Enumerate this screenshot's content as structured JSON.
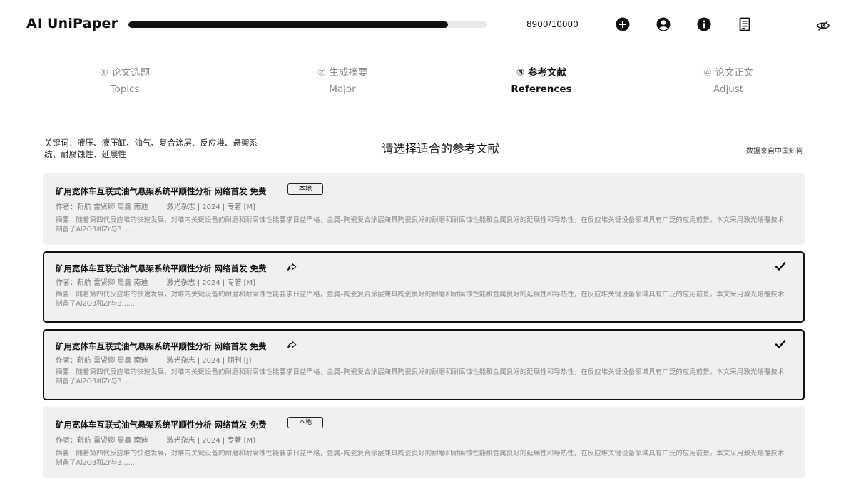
{
  "app": {
    "title": "AI UniPaper"
  },
  "progress": {
    "value": 8900,
    "max": 10000,
    "text": "8900/10000"
  },
  "header_icons": [
    "plus-circle-icon",
    "user-circle-icon",
    "info-circle-icon",
    "document-list-icon",
    "eye-off-icon"
  ],
  "steps": [
    {
      "cn": "① 论文选题",
      "en": "Topics",
      "active": false
    },
    {
      "cn": "② 生成摘要",
      "en": "Major",
      "active": false
    },
    {
      "cn": "③ 参考文献",
      "en": "References",
      "active": true
    },
    {
      "cn": "④ 论文正文",
      "en": "Adjust",
      "active": false
    }
  ],
  "keywords": "关键词：液压、液压缸、油气、复合涂层、反应堆、悬架系统、耐腐蚀性、延展性",
  "section_title": "请选择适合的参考文献",
  "data_source": "数据来自中国知网",
  "references": [
    {
      "title": "矿用宽体车互联式油气悬架系统平顺性分析 网络首发 免费",
      "badge": "本地",
      "authors": "作者：靳航 雷贤卿 周鑫 南迪",
      "source": "激光杂志 | 2024 | 专著 [M]",
      "abstract": "摘要：随着第四代反应堆的快速发展，对堆内关键设备的耐磨和耐腐蚀性能要求日益严格，金属–陶瓷复合涂层兼具陶瓷良好的耐磨和耐腐蚀性能和金属良好的延展性和导热性，在反应堆关键设备领域具有广泛的应用前景。本文采用激光熔覆技术制备了Al2O3和Zr与3......",
      "selected": false
    },
    {
      "title": "矿用宽体车互联式油气悬架系统平顺性分析 网络首发 免费",
      "badge": "",
      "authors": "作者：靳航 雷贤卿 周鑫 南迪",
      "source": "激光杂志 | 2024 | 专著 [M]",
      "abstract": "摘要：随着第四代反应堆的快速发展，对堆内关键设备的耐磨和耐腐蚀性能要求日益严格，金属–陶瓷复合涂层兼具陶瓷良好的耐磨和耐腐蚀性能和金属良好的延展性和导热性，在反应堆关键设备领域具有广泛的应用前景。本文采用激光熔覆技术制备了Al2O3和Zr与3......",
      "selected": true
    },
    {
      "title": "矿用宽体车互联式油气悬架系统平顺性分析 网络首发 免费",
      "badge": "",
      "authors": "作者：靳航 雷贤卿 周鑫 南迪",
      "source": "激光杂志 | 2024 | 期刊 [J]",
      "abstract": "摘要：随着第四代反应堆的快速发展，对堆内关键设备的耐磨和耐腐蚀性能要求日益严格，金属–陶瓷复合涂层兼具陶瓷良好的耐磨和耐腐蚀性能和金属良好的延展性和导热性，在反应堆关键设备领域具有广泛的应用前景。本文采用激光熔覆技术制备了Al2O3和Zr与3......",
      "selected": true
    },
    {
      "title": "矿用宽体车互联式油气悬架系统平顺性分析 网络首发 免费",
      "badge": "本地",
      "authors": "作者：靳航 雷贤卿 周鑫 南迪",
      "source": "激光杂志 | 2024 | 专著 [M]",
      "abstract": "摘要：随着第四代反应堆的快速发展，对堆内关键设备的耐磨和耐腐蚀性能要求日益严格，金属–陶瓷复合涂层兼具陶瓷良好的耐磨和耐腐蚀性能和金属良好的延展性和导热性，在反应堆关键设备领域具有广泛的应用前景。本文采用激光熔覆技术制备了Al2O3和Zr与3......",
      "selected": false
    }
  ]
}
